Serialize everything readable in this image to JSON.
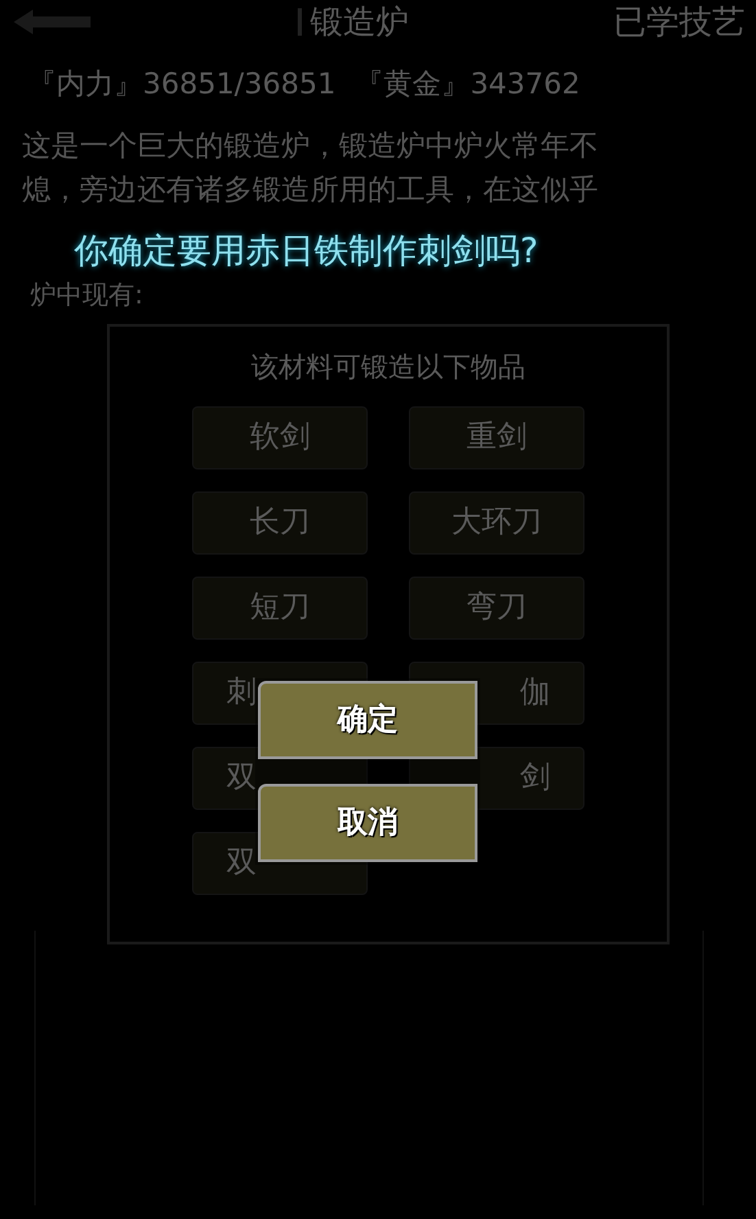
{
  "header": {
    "title": "锻造炉",
    "right_link": "已学技艺"
  },
  "stats": [
    {
      "label": "『内力』",
      "value": "36851/36851"
    },
    {
      "label": "『黄金』",
      "value": "343762"
    }
  ],
  "description": [
    "这是一个巨大的锻造炉，锻造炉中炉火常年不",
    "熄，旁边还有诸多锻造所用的工具，在这似乎"
  ],
  "question": "你确定要用赤日铁制作刺剑吗?",
  "furnace_label": "炉中现有:",
  "panel": {
    "title": "该材料可锻造以下物品",
    "items": [
      {
        "label": "软剑",
        "covered": false
      },
      {
        "label": "重剑",
        "covered": false
      },
      {
        "label": "长刀",
        "covered": false
      },
      {
        "label": "大环刀",
        "covered": false
      },
      {
        "label": "短刀",
        "covered": false
      },
      {
        "label": "弯刀",
        "covered": false
      },
      {
        "label": "刺",
        "covered": true
      },
      {
        "label": "伽",
        "covered": true
      },
      {
        "label": "双",
        "covered": true
      },
      {
        "label": "剑",
        "covered": true
      },
      {
        "label": "双",
        "covered": true
      }
    ]
  },
  "dialog": {
    "buttons": [
      "确定",
      "取消"
    ]
  }
}
